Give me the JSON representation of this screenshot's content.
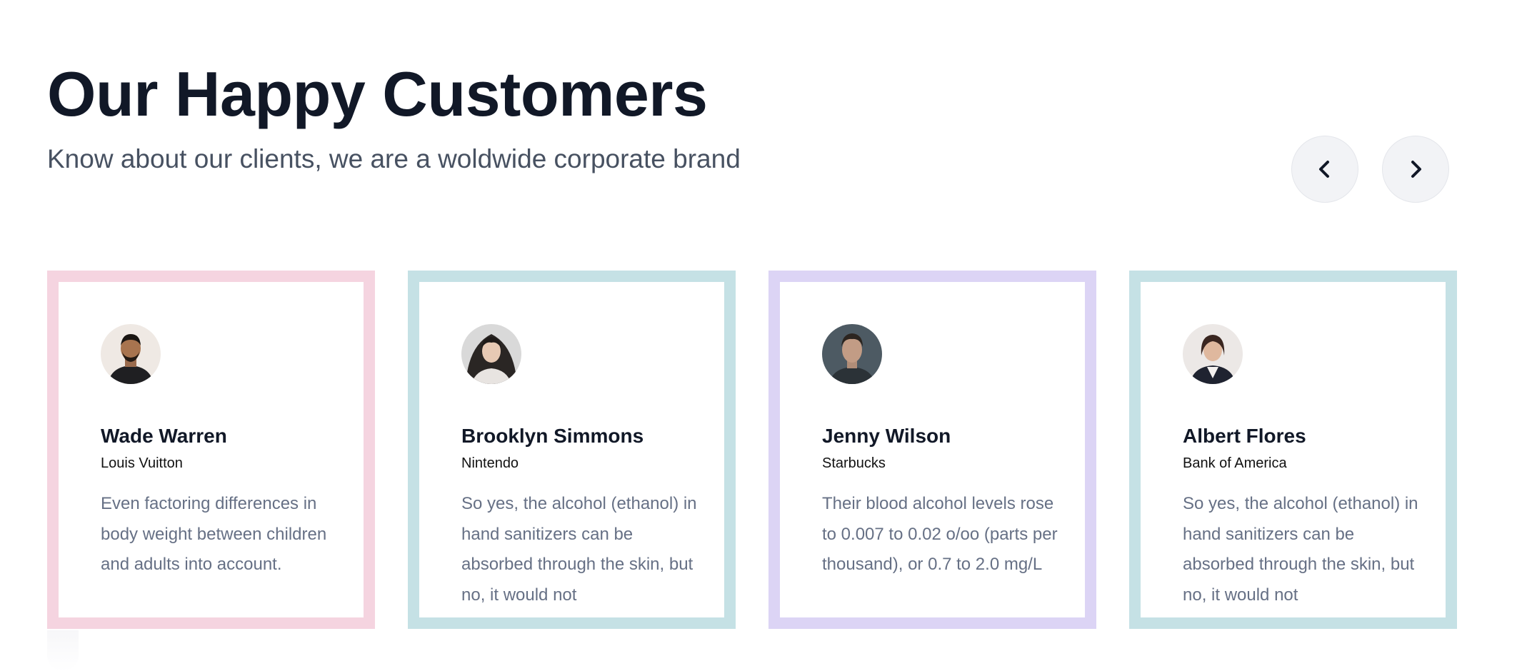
{
  "section": {
    "title": "Our Happy Customers",
    "subtitle": "Know about our clients, we are a woldwide corporate brand"
  },
  "navigation": {
    "prev_icon": "chevron-left-icon",
    "next_icon": "chevron-right-icon"
  },
  "testimonials": [
    {
      "name": "Wade Warren",
      "company": "Louis Vuitton",
      "quote": "Even factoring differences in body weight between children and adults into account.",
      "border_color": "#f5d4e0"
    },
    {
      "name": "Brooklyn Simmons",
      "company": "Nintendo",
      "quote": "So yes, the alcohol (ethanol) in hand sanitizers can be absorbed through the skin, but no, it would not",
      "border_color": "#c5e1e5"
    },
    {
      "name": "Jenny Wilson",
      "company": "Starbucks",
      "quote": "Their blood alcohol levels rose to 0.007 to 0.02 o/oo (parts per thousand), or 0.7 to 2.0 mg/L",
      "border_color": "#dcd4f5"
    },
    {
      "name": "Albert Flores",
      "company": "Bank of America",
      "quote": "So yes, the alcohol (ethanol) in hand sanitizers can be absorbed through the skin, but no, it would not",
      "border_color": "#c5e1e5"
    }
  ]
}
